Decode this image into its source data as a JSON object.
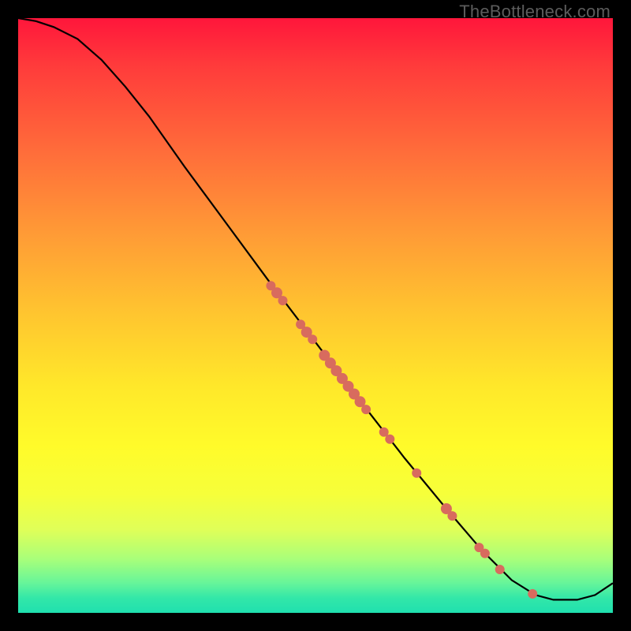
{
  "watermark": "TheBottleneck.com",
  "chart_data": {
    "type": "line",
    "title": "",
    "xlabel": "",
    "ylabel": "",
    "xlim": [
      0,
      100
    ],
    "ylim": [
      0,
      100
    ],
    "grid": false,
    "legend": false,
    "note": "Axes are unlabeled in the source image; x/y are normalized plot-area coordinates.",
    "curve": [
      {
        "x": 0,
        "y": 100
      },
      {
        "x": 3,
        "y": 99.5
      },
      {
        "x": 6,
        "y": 98.5
      },
      {
        "x": 10,
        "y": 96.5
      },
      {
        "x": 14,
        "y": 93
      },
      {
        "x": 18,
        "y": 88.5
      },
      {
        "x": 22,
        "y": 83.5
      },
      {
        "x": 28,
        "y": 75
      },
      {
        "x": 35,
        "y": 65.5
      },
      {
        "x": 42,
        "y": 56
      },
      {
        "x": 50,
        "y": 45.5
      },
      {
        "x": 58,
        "y": 35
      },
      {
        "x": 65,
        "y": 26
      },
      {
        "x": 72,
        "y": 17.5
      },
      {
        "x": 78,
        "y": 10.5
      },
      {
        "x": 83,
        "y": 5.5
      },
      {
        "x": 87,
        "y": 3
      },
      {
        "x": 90,
        "y": 2.2
      },
      {
        "x": 94,
        "y": 2.2
      },
      {
        "x": 97,
        "y": 3
      },
      {
        "x": 100,
        "y": 5
      }
    ],
    "points": [
      {
        "x": 42.5,
        "y": 55.0,
        "r": 6
      },
      {
        "x": 43.5,
        "y": 53.8,
        "r": 7
      },
      {
        "x": 44.5,
        "y": 52.5,
        "r": 6
      },
      {
        "x": 47.5,
        "y": 48.5,
        "r": 6
      },
      {
        "x": 48.5,
        "y": 47.2,
        "r": 7
      },
      {
        "x": 49.5,
        "y": 46.0,
        "r": 6
      },
      {
        "x": 51.5,
        "y": 43.3,
        "r": 7
      },
      {
        "x": 52.5,
        "y": 42.0,
        "r": 7
      },
      {
        "x": 53.5,
        "y": 40.7,
        "r": 7
      },
      {
        "x": 54.5,
        "y": 39.4,
        "r": 7
      },
      {
        "x": 55.5,
        "y": 38.1,
        "r": 7
      },
      {
        "x": 56.5,
        "y": 36.8,
        "r": 7
      },
      {
        "x": 57.5,
        "y": 35.5,
        "r": 7
      },
      {
        "x": 58.5,
        "y": 34.2,
        "r": 6
      },
      {
        "x": 61.5,
        "y": 30.4,
        "r": 6
      },
      {
        "x": 62.5,
        "y": 29.2,
        "r": 6
      },
      {
        "x": 67.0,
        "y": 23.5,
        "r": 6
      },
      {
        "x": 72.0,
        "y": 17.5,
        "r": 7
      },
      {
        "x": 73.0,
        "y": 16.3,
        "r": 6
      },
      {
        "x": 77.5,
        "y": 11.0,
        "r": 6
      },
      {
        "x": 78.5,
        "y": 10.0,
        "r": 6
      },
      {
        "x": 81.0,
        "y": 7.3,
        "r": 6
      },
      {
        "x": 86.5,
        "y": 3.2,
        "r": 6
      }
    ]
  },
  "colors": {
    "dot": "#d86b5e",
    "line": "#000000"
  }
}
